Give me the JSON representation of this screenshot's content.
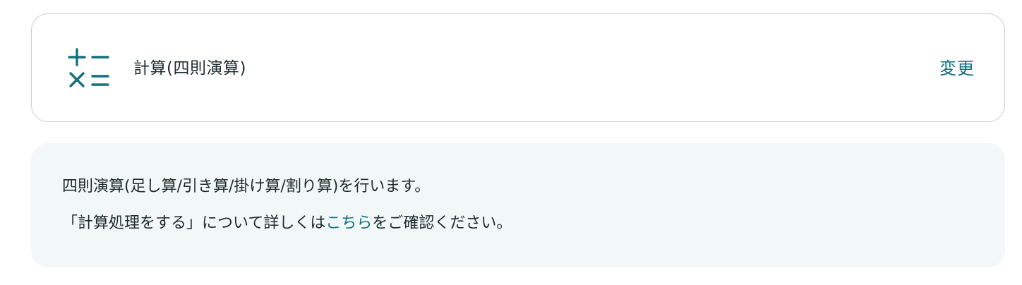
{
  "operation_card": {
    "icon": "calculator-four-operations-icon",
    "title": "計算(四則演算)",
    "change_label": "変更"
  },
  "info_box": {
    "line1": "四則演算(足し算/引き算/掛け算/割り算)を行います。",
    "line2_prefix": "「計算処理をする」について詳しくは",
    "line2_link": "こちら",
    "line2_suffix": "をご確認ください。"
  },
  "colors": {
    "accent": "#14707f",
    "info_background": "#f2f8f8",
    "card_border": "#c9cfd2",
    "text": "#1f2a2e"
  }
}
